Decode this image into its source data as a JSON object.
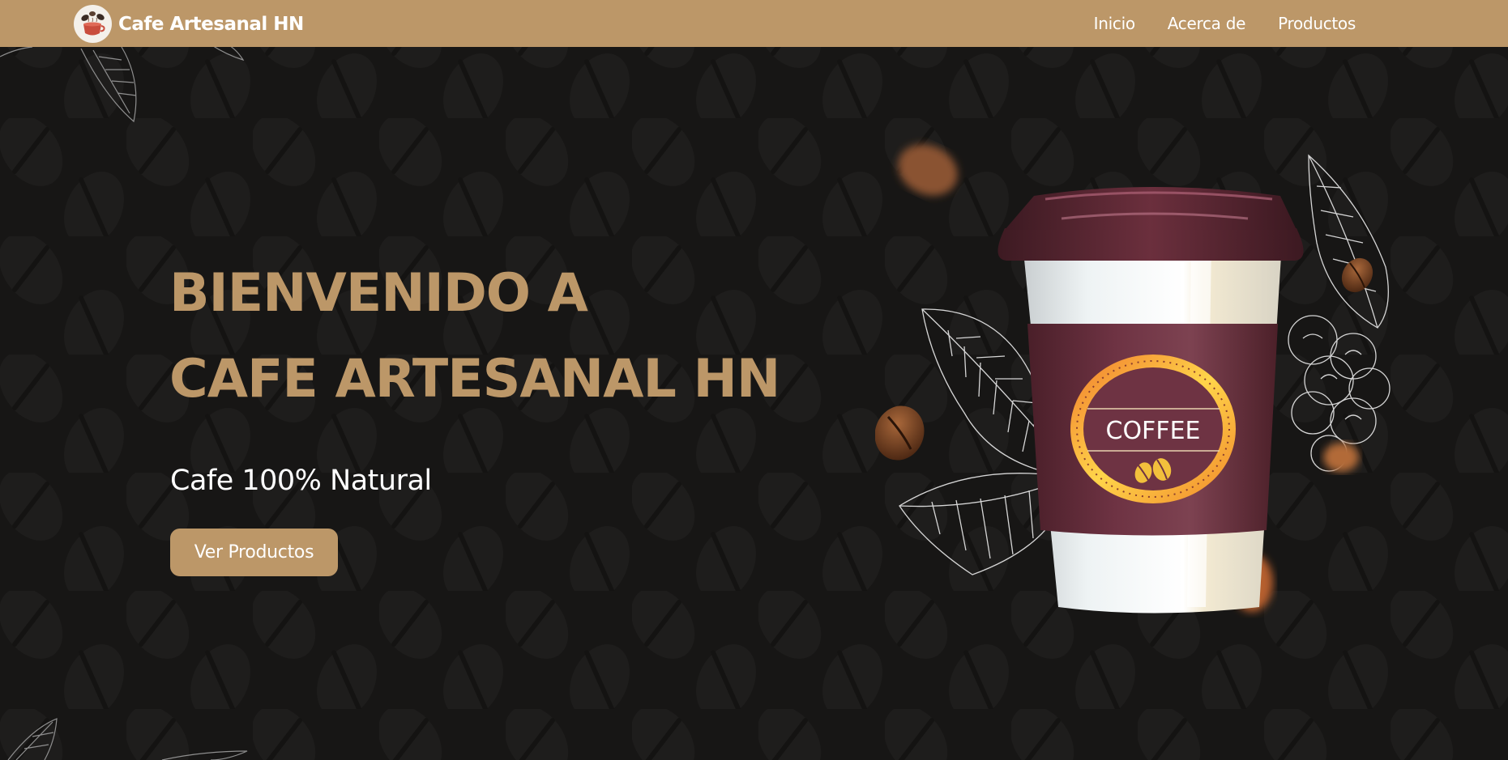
{
  "navbar": {
    "brand": "Cafe Artesanal HN",
    "links": [
      {
        "label": "Inicio"
      },
      {
        "label": "Acerca de"
      },
      {
        "label": "Productos"
      }
    ]
  },
  "hero": {
    "title_line1": "BIENVENIDO A",
    "title_line2": "CAFE ARTESANAL HN",
    "subtitle": "Cafe 100% Natural",
    "cta_label": "Ver Productos",
    "cup_label": "COFFEE"
  },
  "colors": {
    "accent": "#bc9768",
    "background": "#171615",
    "cup_sleeve": "#6b2f3d",
    "text_light": "#ffffff"
  },
  "icons": {
    "logo": "coffee-cup-logo-icon",
    "cup": "coffee-cup-illustration",
    "beans": "coffee-bean-icon",
    "leaves": "coffee-leaf-icon"
  }
}
